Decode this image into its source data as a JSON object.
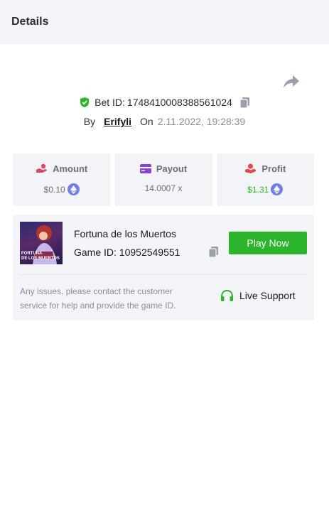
{
  "header": {
    "title": "Details"
  },
  "bet": {
    "label": "Bet ID:",
    "id": "1748410008388561024",
    "by_label": "By",
    "user": "Erifyli",
    "on_label": "On",
    "date": "2.11.2022, 19:28:39"
  },
  "stats": {
    "amount": {
      "label": "Amount",
      "value": "$0.10",
      "icon": "hand-coins-icon",
      "coin": "eth-icon"
    },
    "payout": {
      "label": "Payout",
      "value": "14.0007 x",
      "icon": "card-icon"
    },
    "profit": {
      "label": "Profit",
      "value": "$1.31",
      "icon": "hand-heart-icon",
      "coin": "eth-icon"
    }
  },
  "game": {
    "thumb_caption_line1": "FORTUNA",
    "thumb_caption_line2": "DE LOS MUERTOS",
    "name": "Fortuna de los Muertos",
    "id_label": "Game ID:",
    "id": "10952549551",
    "play_label": "Play Now"
  },
  "support": {
    "issue_text": "Any issues, please contact the customer service for help and provide the game ID.",
    "label": "Live Support"
  },
  "colors": {
    "accent_green": "#2cb52c",
    "profit_green": "#2bb32b",
    "eth_blue": "#6f7fe6",
    "icon_pink": "#e0486b",
    "icon_purple": "#8a3fe0",
    "icon_red": "#e0484b",
    "card_bg": "#f3f4f7"
  }
}
